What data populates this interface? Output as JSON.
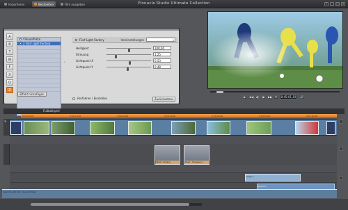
{
  "app": {
    "title": "Pinnacle Studio Ultimate Collection"
  },
  "top_tabs": [
    {
      "label": "Importieren"
    },
    {
      "label": "Bearbeiten"
    },
    {
      "label": "Film ausgeben"
    }
  ],
  "window_controls": [
    "?",
    "_",
    "□",
    "×"
  ],
  "effect_panel": {
    "side_tools": [
      "A",
      "B",
      "T",
      "W",
      "F",
      "X",
      "Q",
      "Z"
    ],
    "effect_list": [
      {
        "label": "Videoeffekte",
        "selected": false
      },
      {
        "label": "2 Fünf Light Factory",
        "selected": true
      }
    ],
    "edit_button": "Effekt hinzufügen",
    "param_header": {
      "name": "Fünf Light Factory",
      "preset_label": "Voreinstellungen",
      "preset_value": ""
    },
    "params": [
      {
        "label": "Helligkeit",
        "value": "100,00",
        "fraction": 0.5
      },
      {
        "label": "Streuung",
        "value": "1,25",
        "fraction": 0.2
      },
      {
        "label": "Lichtpunkt X",
        "value": "0,53",
        "fraction": 0.53
      },
      {
        "label": "Lichtpunkt Y",
        "value": "0,48",
        "fraction": 0.48
      }
    ],
    "radio_label": "Hinführen / Einstellen",
    "reset_button": "Zurücksetzen"
  },
  "player": {
    "timecode": "0:45:01,19",
    "controls": [
      "▶",
      "◀◀",
      "◀|",
      "|▶",
      "▶▶",
      "⟳",
      "🔊"
    ],
    "seek_fraction": 0.05
  },
  "timeline": {
    "title": "Fußballspiel",
    "ruler_ticks": [
      "0:00:00,00",
      "0:00:10,00",
      "0:00:20,00",
      "0:00:30,00",
      "0:00:40,00",
      "0:00:50,00",
      "0:01:00,00"
    ],
    "titles": [
      {
        "label": "Start / Anfang"
      },
      {
        "label": "Start - Eingang C"
      }
    ],
    "audio_label": "Seite 1",
    "music_label": "Rückruf",
    "waveform_label": "Spiel 04 wäh [Sm. Sep Am Star]"
  },
  "colors": {
    "accent": "#e8862a",
    "video_track": "#5b7fa3",
    "ruler": "#e08a34"
  }
}
